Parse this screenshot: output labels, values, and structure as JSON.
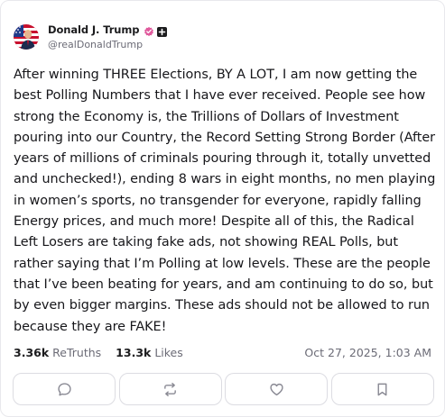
{
  "account": {
    "display_name": "Donald J. Trump",
    "handle": "@realDonaldTrump",
    "avatar_icon": "flag-portrait-avatar",
    "verified_icon": "verified-badge-icon",
    "verified_color": "#e05a9d",
    "plus_badge_icon": "plus-badge-icon"
  },
  "post": {
    "text": "After winning THREE Elections, BY A LOT, I am now getting the best Polling Numbers that I have ever received. People see how strong the Economy is, the Trillions of Dollars of Investment pouring into our Country, the Record Setting Strong Border (After years of millions of criminals pouring through it, totally unvetted and unchecked!), ending 8 wars in eight months, no men playing in women’s sports, no transgender for everyone, rapidly falling Energy prices, and much more! Despite all of this, the Radical Left Losers are taking fake ads, not showing REAL Polls, but rather saying that I’m Polling at low levels. These are the people that I’ve been beating for years, and am continuing to do so, but by even bigger margins. These ads should not be allowed to run because they are FAKE!"
  },
  "stats": {
    "retruths_count": "3.36k",
    "retruths_label": "ReTruths",
    "likes_count": "13.3k",
    "likes_label": "Likes",
    "timestamp": "Oct 27, 2025, 1:03 AM"
  },
  "actions": [
    {
      "name": "reply",
      "icon": "comment-icon"
    },
    {
      "name": "retruth",
      "icon": "repost-icon"
    },
    {
      "name": "like",
      "icon": "heart-icon"
    },
    {
      "name": "bookmark",
      "icon": "bookmark-icon"
    }
  ]
}
